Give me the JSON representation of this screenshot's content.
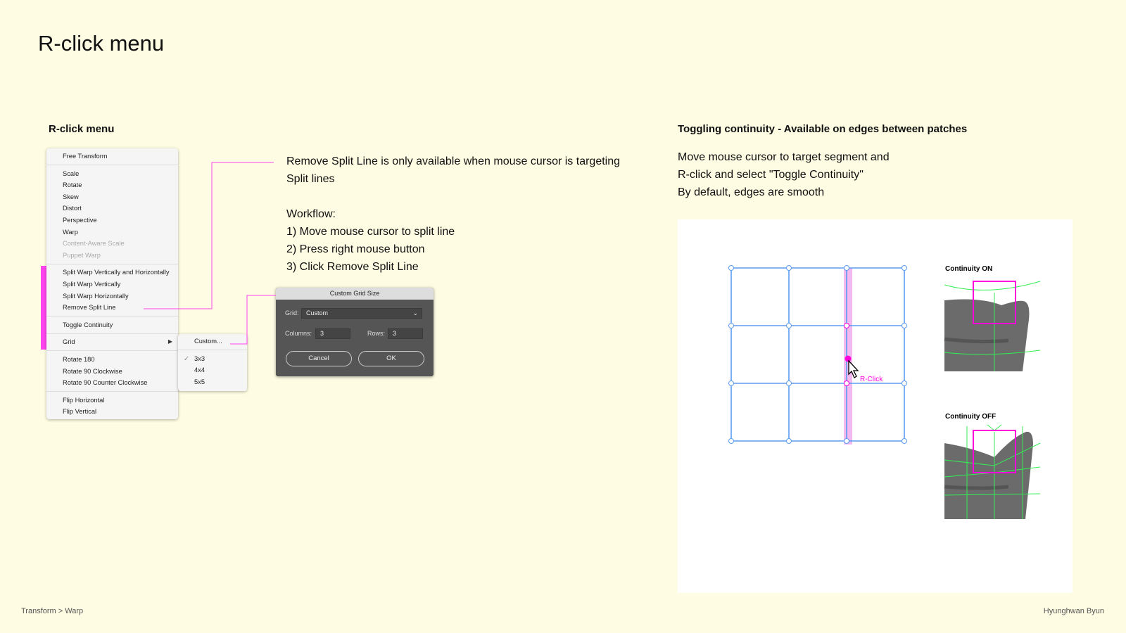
{
  "title": "R-click menu",
  "left_section": {
    "heading": "R-click menu"
  },
  "context_menu": {
    "groups": [
      [
        {
          "label": "Free Transform"
        }
      ],
      [
        {
          "label": "Scale"
        },
        {
          "label": "Rotate"
        },
        {
          "label": "Skew"
        },
        {
          "label": "Distort"
        },
        {
          "label": "Perspective"
        },
        {
          "label": "Warp"
        },
        {
          "label": "Content-Aware Scale",
          "disabled": true
        },
        {
          "label": "Puppet Warp",
          "disabled": true
        }
      ],
      [
        {
          "label": "Split Warp Vertically and Horizontally"
        },
        {
          "label": "Split Warp Vertically"
        },
        {
          "label": "Split Warp Horizontally"
        },
        {
          "label": "Remove Split Line"
        }
      ],
      [
        {
          "label": "Toggle Continuity"
        }
      ],
      [
        {
          "label": "Grid",
          "submenu": true
        }
      ],
      [
        {
          "label": "Rotate 180"
        },
        {
          "label": "Rotate 90 Clockwise"
        },
        {
          "label": "Rotate 90 Counter Clockwise"
        }
      ],
      [
        {
          "label": "Flip Horizontal"
        },
        {
          "label": "Flip Vertical"
        }
      ]
    ],
    "highlight_color": "#ff44ee"
  },
  "grid_submenu": {
    "custom": "Custom...",
    "check": "✓",
    "options": [
      {
        "label": "3x3",
        "checked": true
      },
      {
        "label": "4x4"
      },
      {
        "label": "5x5"
      }
    ]
  },
  "dialog": {
    "title": "Custom Grid Size",
    "grid_label": "Grid:",
    "grid_value": "Custom",
    "columns_label": "Columns:",
    "columns_value": "3",
    "rows_label": "Rows:",
    "rows_value": "3",
    "cancel": "Cancel",
    "ok": "OK"
  },
  "annotation": {
    "lines": [
      "Remove Split Line is only available when mouse cursor is targeting",
      "Split lines",
      "",
      "Workflow:",
      "1) Move mouse cursor to split line",
      "2) Press right mouse button",
      "3) Click Remove Split Line"
    ]
  },
  "right_section": {
    "heading": "Toggling continuity - Available on edges between patches",
    "lines": [
      "Move mouse cursor to target segment and",
      "R-click and select \"Toggle Continuity\"",
      "By default, edges are smooth"
    ],
    "rclick_label": "R-Click",
    "continuity_on": "Continuity ON",
    "continuity_off": "Continuity OFF",
    "colors": {
      "grid": "#5b9bf0",
      "accent": "#ff00dd",
      "mesh": "#22dd44"
    }
  },
  "footer": {
    "left": "Transform > Warp",
    "right": "Hyunghwan Byun"
  }
}
